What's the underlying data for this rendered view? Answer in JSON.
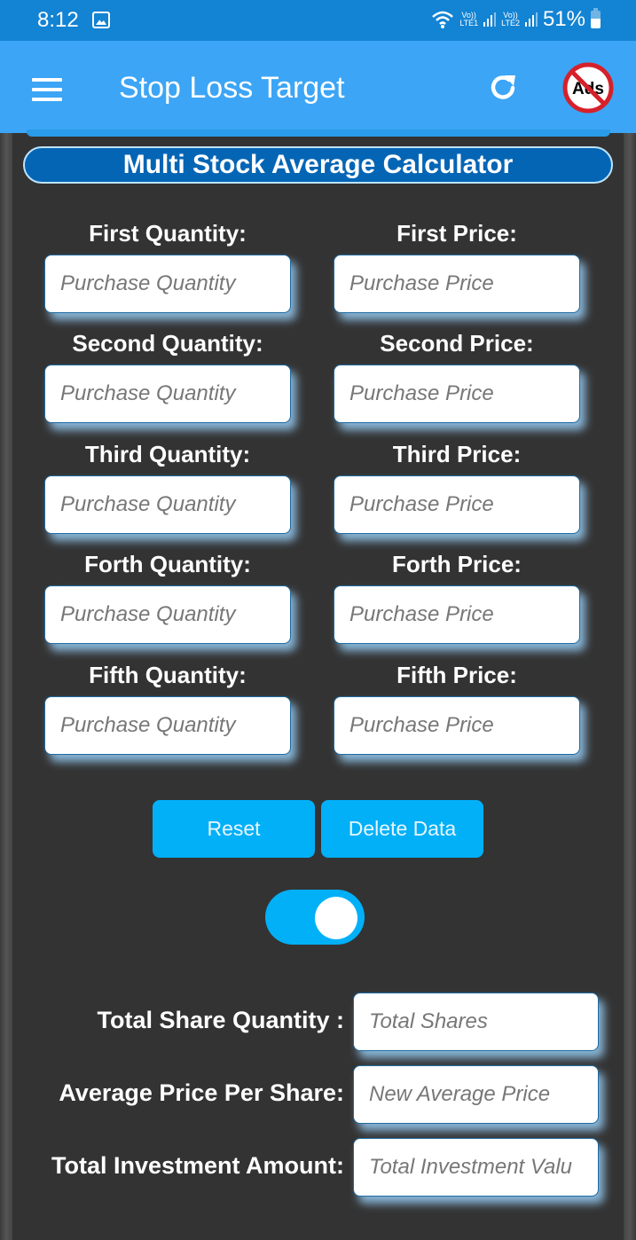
{
  "status_bar": {
    "time": "8:12",
    "sim1_label_top": "Vo))",
    "sim1_label_bottom": "LTE1",
    "sim2_label_top": "Vo))",
    "sim2_label_bottom": "LTE2",
    "battery": "51%"
  },
  "app_bar": {
    "title": "Stop Loss Target",
    "noads_text": "Ads"
  },
  "calculator": {
    "title": "Multi Stock Average Calculator",
    "rows": [
      {
        "qty_label": "First Quantity:",
        "qty_placeholder": "Purchase Quantity",
        "qty_value": "",
        "price_label": "First Price:",
        "price_placeholder": "Purchase Price",
        "price_value": ""
      },
      {
        "qty_label": "Second Quantity:",
        "qty_placeholder": "Purchase Quantity",
        "qty_value": "",
        "price_label": "Second Price:",
        "price_placeholder": "Purchase Price",
        "price_value": ""
      },
      {
        "qty_label": "Third Quantity:",
        "qty_placeholder": "Purchase Quantity",
        "qty_value": "",
        "price_label": "Third Price:",
        "price_placeholder": "Purchase Price",
        "price_value": ""
      },
      {
        "qty_label": "Forth Quantity:",
        "qty_placeholder": "Purchase Quantity",
        "qty_value": "",
        "price_label": "Forth Price:",
        "price_placeholder": "Purchase Price",
        "price_value": ""
      },
      {
        "qty_label": "Fifth Quantity:",
        "qty_placeholder": "Purchase Quantity",
        "qty_value": "",
        "price_label": "Fifth Price:",
        "price_placeholder": "Purchase Price",
        "price_value": ""
      }
    ],
    "reset_label": "Reset",
    "delete_label": "Delete Data",
    "toggle_on": true,
    "results": [
      {
        "label": "Total Share Quantity :",
        "placeholder": "Total Shares"
      },
      {
        "label": "Average Price Per Share:",
        "placeholder": "New Average Price"
      },
      {
        "label": "Total Investment Amount:",
        "placeholder": "Total Investment Valu"
      }
    ]
  },
  "colors": {
    "status_bar": "#1383d3",
    "app_bar": "#3ca5f5",
    "title_pill": "#0565b5",
    "button": "#02b0f8",
    "background": "#333333"
  }
}
